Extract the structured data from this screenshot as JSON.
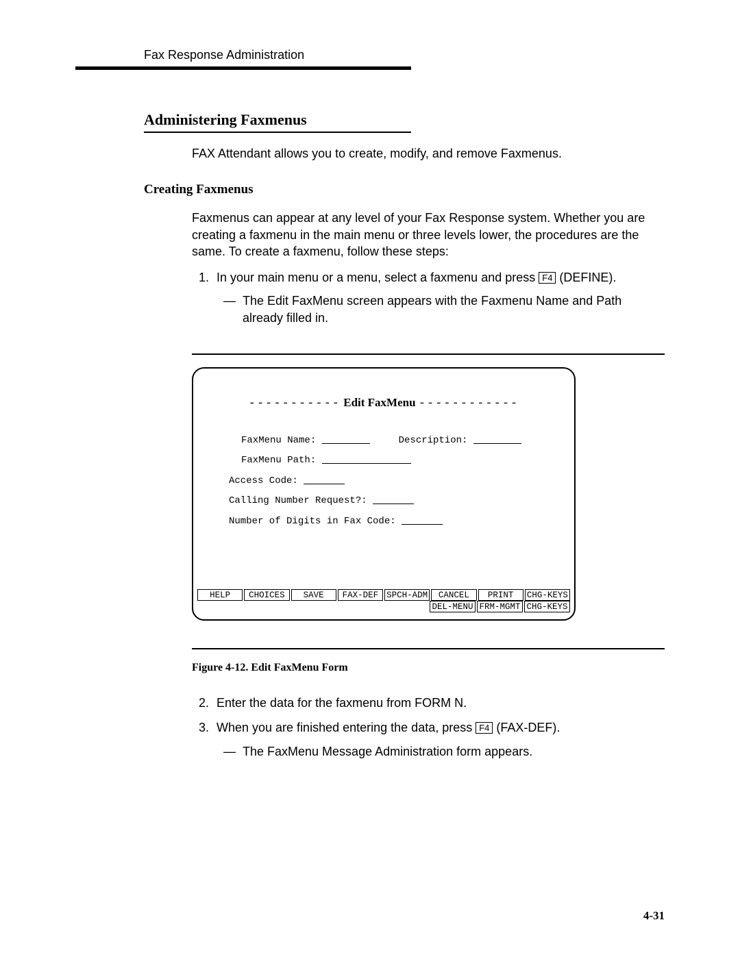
{
  "header": {
    "running": "Fax Response Administration"
  },
  "section": {
    "title": "Administering Faxmenus",
    "intro": "FAX Attendant allows you to create, modify, and remove Faxmenus."
  },
  "subsection": {
    "title": "Creating Faxmenus",
    "para": "Faxmenus can appear at any level of your Fax Response system. Whether you are creating a faxmenu in the main menu or three levels lower, the procedures are the same. To create a faxmenu, follow these steps:"
  },
  "steps": {
    "s1_a": "In your main menu or a menu, select a faxmenu and press ",
    "s1_key": "F4",
    "s1_b": " (DEFINE).",
    "s1_sub": "The Edit FaxMenu screen appears with the Faxmenu Name and Path already filled in.",
    "s2": "Enter the data for the faxmenu from FORM N.",
    "s3_a": "When you are finished entering the data, press ",
    "s3_key": "F4",
    "s3_b": " (FAX-DEF).",
    "s3_sub": "The FaxMenu Message Administration form appears."
  },
  "form": {
    "title": "Edit FaxMenu",
    "fields": {
      "name": "FaxMenu Name:",
      "desc": "Description:",
      "path": "FaxMenu Path:",
      "access": "Access Code:",
      "calling": "Calling Number Request?:",
      "digits": "Number of Digits in Fax Code:"
    },
    "keys_row1": [
      "HELP",
      "CHOICES",
      "SAVE",
      "FAX-DEF",
      "SPCH-ADM",
      "CANCEL",
      "PRINT",
      "CHG-KEYS"
    ],
    "keys_row2": [
      "DEL-MENU",
      "FRM-MGMT",
      "CHG-KEYS"
    ]
  },
  "figure_caption": "Figure 4-12.  Edit FaxMenu Form",
  "page_number": "4-31"
}
